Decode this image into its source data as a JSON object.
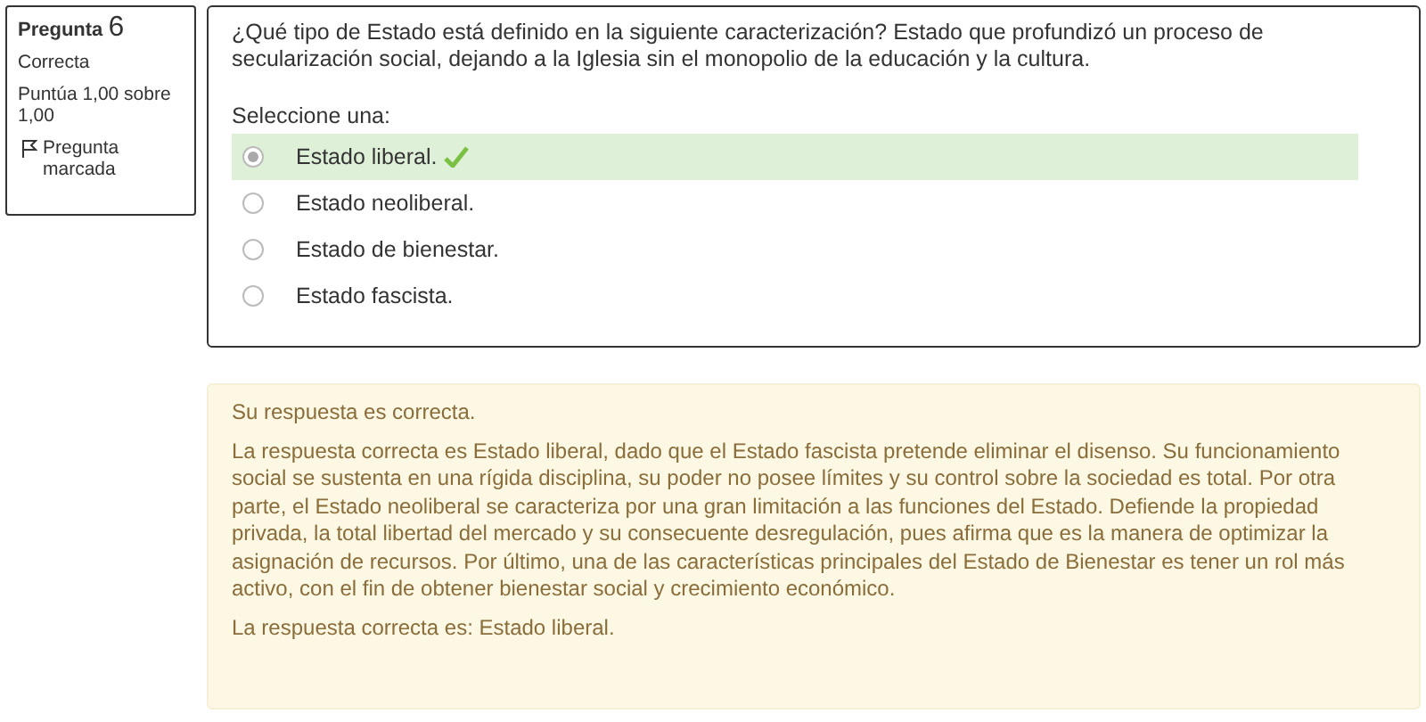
{
  "info": {
    "label": "Pregunta",
    "number": "6",
    "status": "Correcta",
    "score": "Puntúa 1,00 sobre 1,00",
    "flag": "Pregunta marcada"
  },
  "question": {
    "text": "¿Qué tipo de Estado está definido en la siguiente caracterización? Estado que profundizó un proceso de secularización social, dejando a la Iglesia sin el monopolio de la educación y la cultura.",
    "prompt": "Seleccione una:",
    "options": [
      {
        "label": "Estado liberal.",
        "selected": true,
        "correct": true
      },
      {
        "label": "Estado neoliberal.",
        "selected": false,
        "correct": false
      },
      {
        "label": "Estado de bienestar.",
        "selected": false,
        "correct": false
      },
      {
        "label": "Estado fascista.",
        "selected": false,
        "correct": false
      }
    ]
  },
  "feedback": {
    "result": "Su respuesta es correcta.",
    "explanation": "La respuesta correcta es Estado liberal, dado que el Estado fascista pretende eliminar el disenso. Su funcionamiento social se sustenta en una rígida disciplina, su poder no posee límites y su control sobre la sociedad es total. Por otra parte, el Estado neoliberal se caracteriza por una gran limitación a las funciones del Estado. Defiende la propiedad privada, la total libertad del mercado y su consecuente desregulación, pues afirma que es la manera de optimizar la asignación de recursos. Por último, una de las características principales del Estado de Bienestar es tener un rol más activo, con el fin de obtener bienestar social y crecimiento económico.",
    "answer": "La respuesta correcta es: Estado liberal."
  }
}
